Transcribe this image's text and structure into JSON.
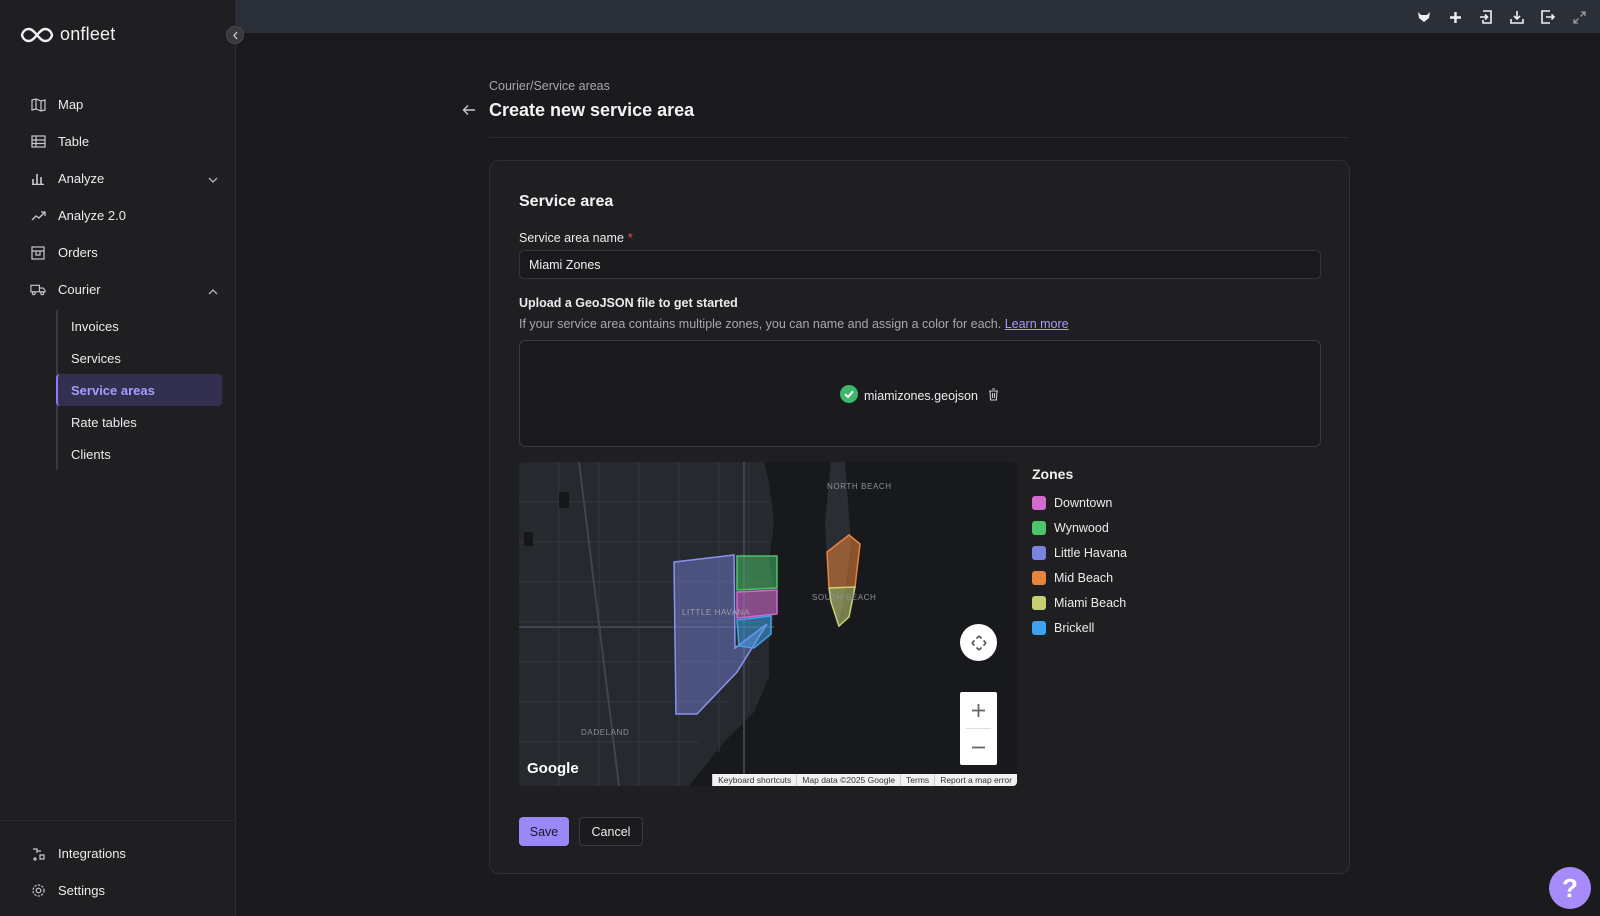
{
  "app": {
    "brand": "onfleet"
  },
  "sidebar": {
    "items": [
      {
        "label": "Map",
        "icon": "map-icon"
      },
      {
        "label": "Table",
        "icon": "table-icon"
      },
      {
        "label": "Analyze",
        "icon": "bar-chart-icon"
      },
      {
        "label": "Analyze 2.0",
        "icon": "trend-icon"
      },
      {
        "label": "Orders",
        "icon": "orders-icon"
      },
      {
        "label": "Courier",
        "icon": "truck-icon"
      }
    ],
    "courier_sub": [
      {
        "label": "Invoices"
      },
      {
        "label": "Services"
      },
      {
        "label": "Service areas",
        "active": true
      },
      {
        "label": "Rate tables"
      },
      {
        "label": "Clients"
      }
    ],
    "bottom": [
      {
        "label": "Integrations",
        "icon": "integrations-icon"
      },
      {
        "label": "Settings",
        "icon": "settings-gear-icon"
      }
    ]
  },
  "page": {
    "breadcrumb": "Courier/Service areas",
    "title": "Create new service area"
  },
  "form": {
    "section_title": "Service area",
    "name_label": "Service area name",
    "required_mark": "*",
    "name_value": "Miami Zones",
    "upload_title": "Upload a GeoJSON file to get started",
    "upload_desc": "If your service area contains multiple zones, you can name and assign a color for each.",
    "learn_more": "Learn more",
    "file_name": "miamizones.geojson",
    "save_label": "Save",
    "cancel_label": "Cancel"
  },
  "map": {
    "labels": {
      "north_beach": "NORTH BEACH",
      "south_beach": "SOUTH BEACH",
      "little_havana": "LITTLE HAVANA",
      "dadeland": "DADELAND"
    },
    "google": "Google",
    "footer": [
      "Keyboard shortcuts",
      "Map data ©2025 Google",
      "Terms",
      "Report a map error"
    ]
  },
  "zones": {
    "title": "Zones",
    "items": [
      {
        "name": "Downtown",
        "color": "#d26ad0"
      },
      {
        "name": "Wynwood",
        "color": "#4cc46a"
      },
      {
        "name": "Little Havana",
        "color": "#7b83e0"
      },
      {
        "name": "Mid Beach",
        "color": "#e8833a"
      },
      {
        "name": "Miami Beach",
        "color": "#c7cf72"
      },
      {
        "name": "Brickell",
        "color": "#3da3ee"
      }
    ]
  },
  "help": {
    "label": "?"
  }
}
